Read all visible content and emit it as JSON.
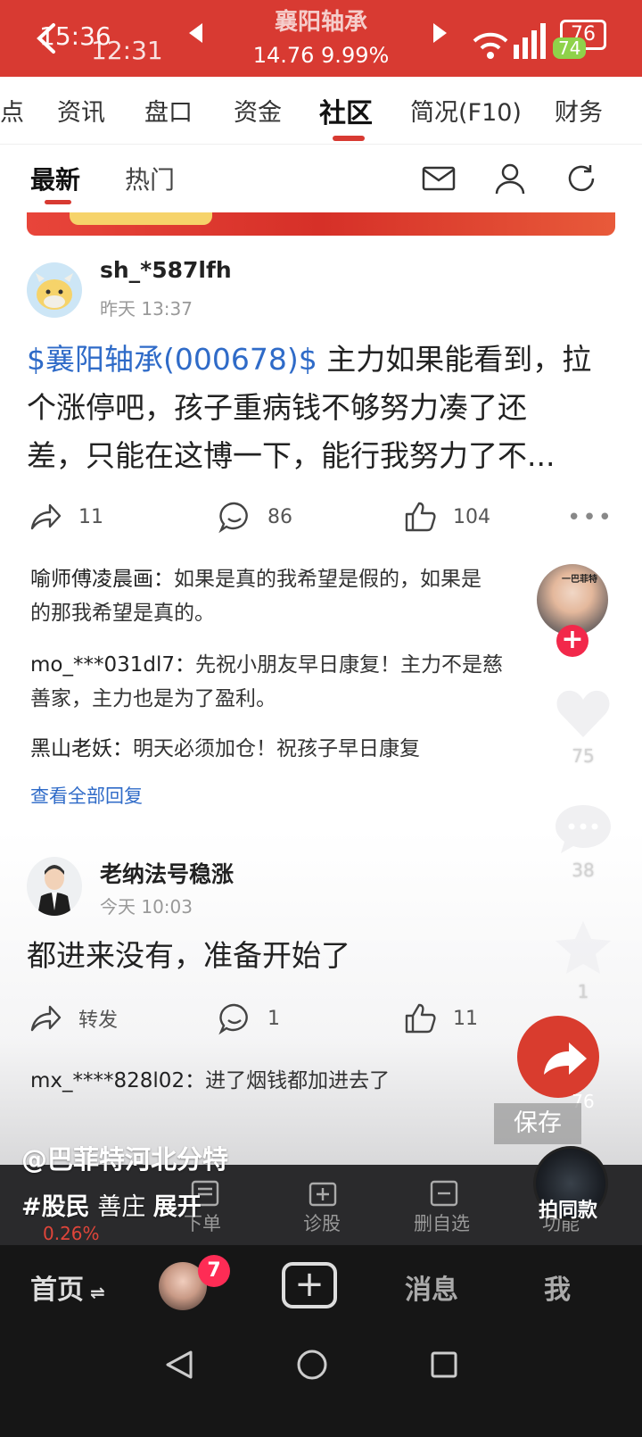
{
  "header": {
    "clock_a": "15:36",
    "clock_b": "12:31",
    "stock_name": "襄阳轴承",
    "stock_price": "14.76 9.99%",
    "battery": "76",
    "battery_pct": "74"
  },
  "tabs": [
    "点",
    "资讯",
    "盘口",
    "资金",
    "社区",
    "简况(F10)",
    "财务"
  ],
  "subtabs": {
    "latest": "最新",
    "hot": "热门"
  },
  "post1": {
    "username": "sh_*587lfh",
    "time": "昨天 13:37",
    "tag": "$襄阳轴承(000678)$",
    "text_line1": " 主力如果能看到，拉",
    "text_line2": "个涨停吧，孩子重病钱不够努力凑了还",
    "text_line3": "差，只能在这博一下，能行我努力了不...",
    "shares": "11",
    "comments": "86",
    "likes": "104",
    "more": "•••",
    "replies": [
      {
        "user": "喻师傅凌晨画：",
        "text": "如果是真的我希望是假的，如果是",
        "text2": "的那我希望是真的。"
      },
      {
        "user": "mo_***031dl7：",
        "text": "先祝小朋友早日康复！主力不是慈",
        "text2": "善家，主力也是为了盈利。"
      },
      {
        "user": "黑山老妖：",
        "text": "明天必须加仓！祝孩子早日康复",
        "text2": ""
      }
    ],
    "see_all": "查看全部回复"
  },
  "post2": {
    "username": "老纳法号稳涨",
    "time": "今天 10:03",
    "text": "都进来没有，准备开始了",
    "share_label": "转发",
    "comments": "1",
    "likes": "11",
    "reply": {
      "user": "mx_****828l02：",
      "text": "进了烟钱都加进去了"
    }
  },
  "side": {
    "avatar_label": "一巴菲特",
    "likes": "75",
    "comments": "38",
    "favorites": "1",
    "shares": "76"
  },
  "overlay": {
    "handle": "@巴菲特河北分特",
    "caption_tag": "#股民",
    "caption_text": " 善庄 ",
    "expand": "展开",
    "save": "保存",
    "music": "拍同款"
  },
  "app_toolbar": {
    "pct": "0.26%",
    "items": [
      "下单",
      "诊股",
      "删自选",
      "功能"
    ]
  },
  "bottom_nav": {
    "home": "首页",
    "badge": "7",
    "messages": "消息",
    "me": "我"
  }
}
